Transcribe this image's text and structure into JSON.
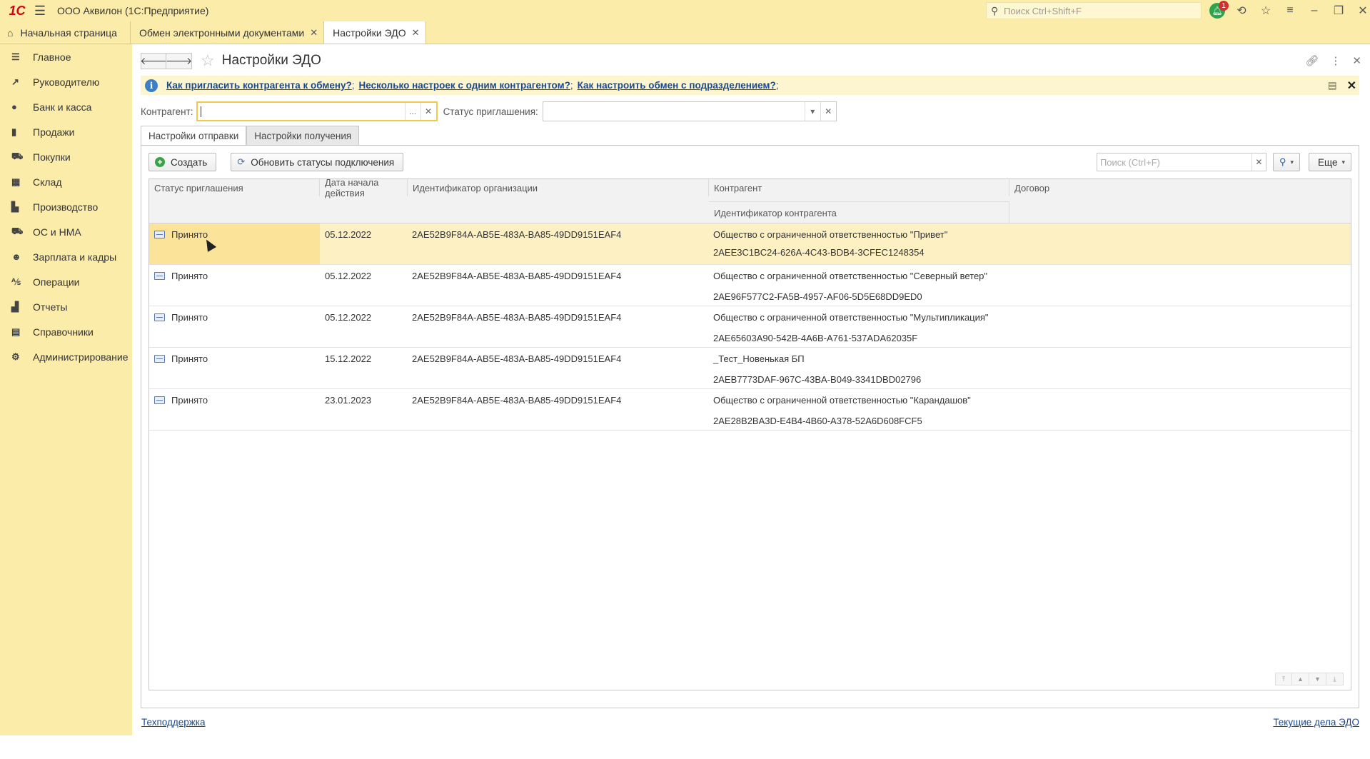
{
  "app": {
    "logo": "1С",
    "title": "ООО Аквилон  (1С:Предприятие)",
    "search_placeholder": "Поиск Ctrl+Shift+F",
    "notification_count": "1"
  },
  "tabs": {
    "home": "Начальная страница",
    "items": [
      {
        "label": "Обмен электронными документами"
      },
      {
        "label": "Настройки ЭДО"
      }
    ]
  },
  "sidebar": {
    "items": [
      {
        "label": "Главное",
        "icon": "menu-icon"
      },
      {
        "label": "Руководителю",
        "icon": "trend-icon"
      },
      {
        "label": "Банк и касса",
        "icon": "coins-icon"
      },
      {
        "label": "Продажи",
        "icon": "bag-icon"
      },
      {
        "label": "Покупки",
        "icon": "cart-icon"
      },
      {
        "label": "Склад",
        "icon": "warehouse-icon"
      },
      {
        "label": "Производство",
        "icon": "factory-icon"
      },
      {
        "label": "ОС и НМА",
        "icon": "truck-icon"
      },
      {
        "label": "Зарплата и кадры",
        "icon": "person-icon"
      },
      {
        "label": "Операции",
        "icon": "operations-icon"
      },
      {
        "label": "Отчеты",
        "icon": "bar-chart-icon"
      },
      {
        "label": "Справочники",
        "icon": "book-icon"
      },
      {
        "label": "Администрирование",
        "icon": "gear-icon"
      }
    ]
  },
  "form": {
    "title": "Настройки ЭДО",
    "info_links": [
      "Как пригласить контрагента к обмену?",
      "Несколько настроек с одним контрагентом?",
      "Как настроить обмен с подразделением?"
    ],
    "filter": {
      "counterparty_label": "Контрагент:",
      "counterparty_value": "",
      "status_label": "Статус приглашения:",
      "status_value": ""
    },
    "subtabs": [
      "Настройки отправки",
      "Настройки получения"
    ],
    "toolbar": {
      "create": "Создать",
      "refresh": "Обновить статусы подключения",
      "search_placeholder": "Поиск (Ctrl+F)",
      "more": "Еще"
    },
    "table": {
      "columns": {
        "status": "Статус приглашения",
        "date": "Дата начала действия",
        "org_id": "Идентификатор организации",
        "counterparty": "Контрагент",
        "counterparty_id": "Идентификатор контрагента",
        "contract": "Договор"
      },
      "rows": [
        {
          "status": "Принято",
          "date": "05.12.2022",
          "org_id": "2AE52B9F84A-AB5E-483A-BA85-49DD9151EAF4",
          "counterparty": "Общество с ограниченной ответственностью \"Привет\"",
          "counterparty_id": "2AEE3C1BC24-626A-4C43-BDB4-3CFEC1248354",
          "contract": ""
        },
        {
          "status": "Принято",
          "date": "05.12.2022",
          "org_id": "2AE52B9F84A-AB5E-483A-BA85-49DD9151EAF4",
          "counterparty": "Общество с ограниченной ответственностью \"Северный ветер\"",
          "counterparty_id": "2AE96F577C2-FA5B-4957-AF06-5D5E68DD9ED0",
          "contract": ""
        },
        {
          "status": "Принято",
          "date": "05.12.2022",
          "org_id": "2AE52B9F84A-AB5E-483A-BA85-49DD9151EAF4",
          "counterparty": "Общество с ограниченной ответственностью \"Мультипликация\"",
          "counterparty_id": "2AE65603A90-542B-4A6B-A761-537ADA62035F",
          "contract": ""
        },
        {
          "status": "Принято",
          "date": "15.12.2022",
          "org_id": "2AE52B9F84A-AB5E-483A-BA85-49DD9151EAF4",
          "counterparty": "_Тест_Новенькая БП",
          "counterparty_id": "2AEB7773DAF-967C-43BA-B049-3341DBD02796",
          "contract": ""
        },
        {
          "status": "Принято",
          "date": "23.01.2023",
          "org_id": "2AE52B9F84A-AB5E-483A-BA85-49DD9151EAF4",
          "counterparty": "Общество с ограниченной ответственностью \"Карандашов\"",
          "counterparty_id": "2AE28B2BA3D-E4B4-4B60-A378-52A6D608FCF5",
          "contract": ""
        }
      ]
    },
    "footer": {
      "support": "Техподдержка",
      "current_tasks": "Текущие дела ЭДО"
    }
  },
  "colors": {
    "sidebar_bg": "#fbeca9",
    "selected_row": "#fdf1c4",
    "link": "#1a4b91"
  }
}
